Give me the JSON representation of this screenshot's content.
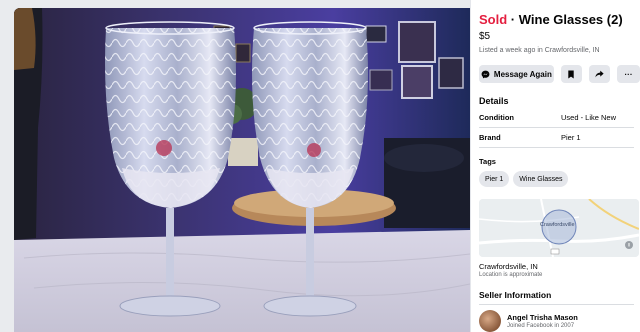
{
  "listing": {
    "sold_label": "Sold",
    "separator": " · ",
    "title": "Wine Glasses (2)",
    "price": "$5",
    "listed_text": "Listed a week ago in Crawfordsville, IN"
  },
  "actions": {
    "message_label": "Message Again",
    "save_icon": "bookmark-icon",
    "share_icon": "share-icon",
    "more_label": "···"
  },
  "details": {
    "heading": "Details",
    "condition_label": "Condition",
    "condition_value": "Used - Like New",
    "brand_label": "Brand",
    "brand_value": "Pier 1",
    "tags_heading": "Tags",
    "tags": [
      "Pier 1",
      "Wine Glasses"
    ]
  },
  "location": {
    "map_label": "Crawfordsville",
    "city": "Crawfordsville, IN",
    "note": "Location is approximate"
  },
  "seller": {
    "heading": "Seller Information",
    "name": "Angel Trisha Mason",
    "joined": "Joined Facebook in 2007"
  },
  "colors": {
    "sold_red": "#e41e3f",
    "button_gray": "#e4e6eb",
    "text_secondary": "#65676b"
  }
}
